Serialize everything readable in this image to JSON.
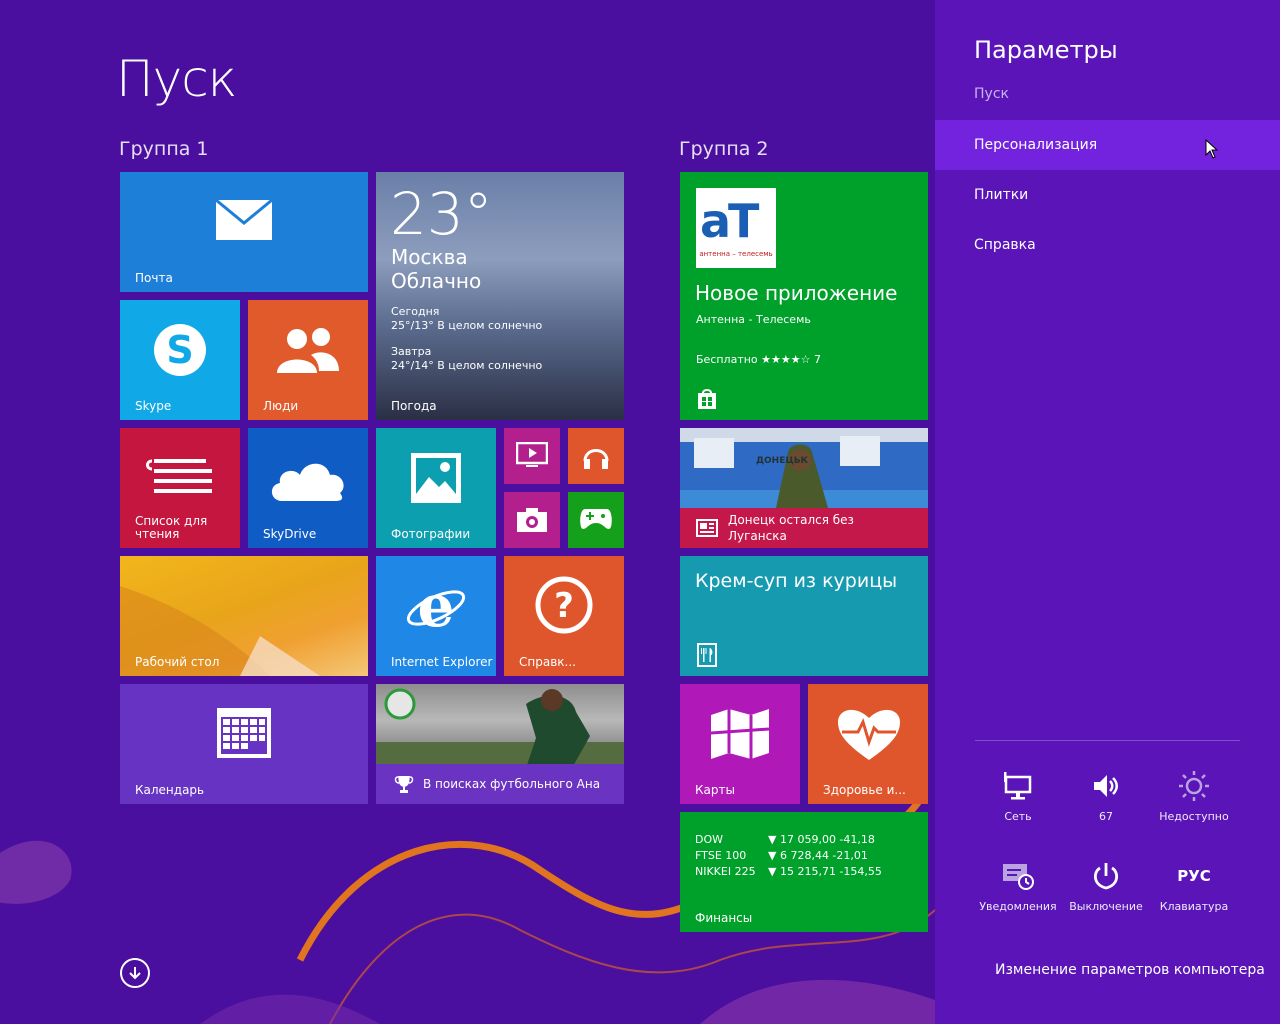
{
  "start": {
    "title": "Пуск"
  },
  "groups": {
    "g1": "Группа 1",
    "g2": "Группа 2"
  },
  "tiles": {
    "mail": "Почта",
    "weather": {
      "temp": "23°",
      "city": "Москва",
      "condition": "Облачно",
      "today_label": "Сегодня",
      "today": "25°/13° В целом солнечно",
      "tomorrow_label": "Завтра",
      "tomorrow": "24°/14° В целом солнечно",
      "label": "Погода"
    },
    "skype": "Skype",
    "people": "Люди",
    "reading_list": "Список для чтения",
    "skydrive": "SkyDrive",
    "photos": "Фотографии",
    "desktop": "Рабочий стол",
    "ie": "Internet Explorer",
    "help": "Справк...",
    "calendar": "Календарь",
    "sports": "В поисках футбольного Ана",
    "store": {
      "logo": "aT",
      "logo_sub": "антенна – телесемь",
      "title": "Новое приложение",
      "app": "Антенна - Телесемь",
      "price": "Бесплатно ★★★★☆ 7"
    },
    "news": {
      "line1": "Донецк остался без",
      "line2": "Луганска",
      "sign": "ДОНЕЦЬК"
    },
    "food": "Крем-суп из курицы",
    "maps": "Карты",
    "health": "Здоровье и...",
    "finance": {
      "label": "Финансы",
      "rows": [
        {
          "name": "DOW",
          "value": "▼ 17 059,00 -41,18"
        },
        {
          "name": "FTSE 100",
          "value": "▼ 6 728,44 -21,01"
        },
        {
          "name": "NIKKEI 225",
          "value": "▼ 15 215,71 -154,55"
        }
      ]
    }
  },
  "charm": {
    "title": "Параметры",
    "subtitle": "Пуск",
    "items": [
      {
        "label": "Персонализация"
      },
      {
        "label": "Плитки"
      },
      {
        "label": "Справка"
      }
    ],
    "quick": {
      "network": "Сеть",
      "volume": "67",
      "brightness": "Недоступно",
      "notifications": "Уведомления",
      "power": "Выключение",
      "keyboard_glyph": "РУС",
      "keyboard": "Клавиатура"
    },
    "change_pc_settings": "Изменение параметров компьютера"
  },
  "colors": {
    "background": "#4a0f9e",
    "charm": "#5a14b8",
    "selected": "#7322de",
    "mail": "#1e7fd9",
    "skype": "#10a8e6",
    "people": "#e05a2b",
    "reading": "#c4163f",
    "skydrive": "#0f5cc4",
    "photos": "#0c9fb0",
    "video": "#b31f8c",
    "music": "#e0562c",
    "camera": "#b31f8c",
    "games": "#15a01b",
    "ie": "#1f87e6",
    "help": "#e0562c",
    "calendar": "#6733c2",
    "store": "#00a12a",
    "news": "#c4174a",
    "food": "#159ab0",
    "maps": "#b019b8",
    "health": "#e0562c",
    "finance": "#00a12a"
  }
}
